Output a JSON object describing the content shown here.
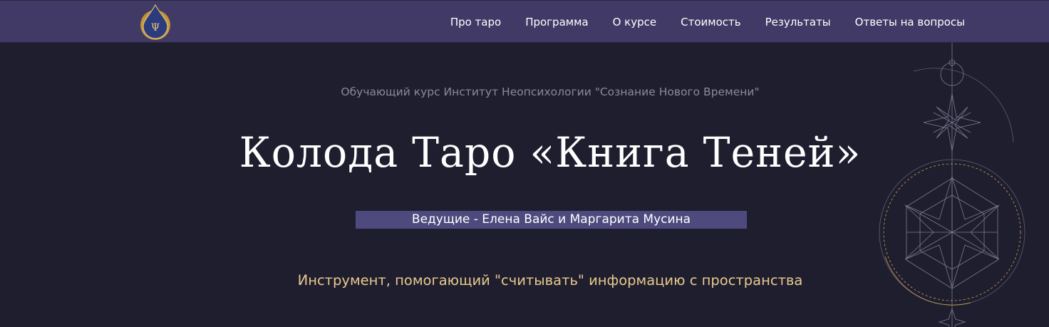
{
  "header": {
    "nav": [
      {
        "id": "about-tarot",
        "label": "Про таро"
      },
      {
        "id": "program",
        "label": "Программа"
      },
      {
        "id": "about-course",
        "label": "О курсе"
      },
      {
        "id": "price",
        "label": "Стоимость"
      },
      {
        "id": "results",
        "label": "Результаты"
      },
      {
        "id": "faq",
        "label": "Ответы на вопросы"
      }
    ],
    "logo": {
      "icon": "psi-drop-logo",
      "glyph": "Ψ"
    }
  },
  "hero": {
    "subtitle": "Обучающий курс Институт Неопсихологии \"Сознание Нового Времени\"",
    "title": "Колода Таро «Книга Теней»",
    "hosts": "Ведущие - Елена Вайс и Маргарита Мусина",
    "tagline": "Инструмент, помогающий \"считывать\" информацию с пространства"
  },
  "colors": {
    "background": "#1f1e2e",
    "navbar": "#413a66",
    "hosts_bg": "#4e4a7e",
    "tagline": "#e7c98d",
    "subtitle": "#8b8a98",
    "gold": "#c9a35a"
  }
}
